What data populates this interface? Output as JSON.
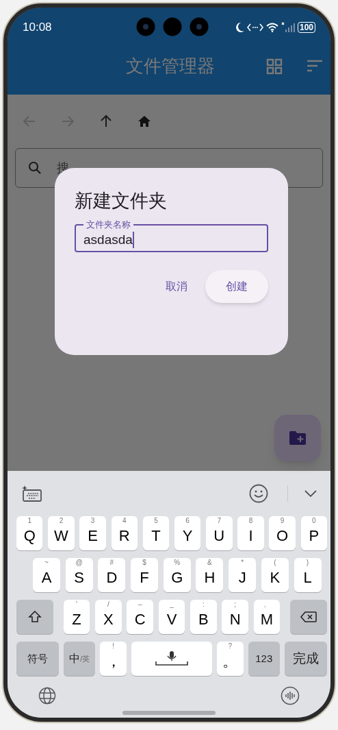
{
  "status_bar": {
    "time": "10:08",
    "battery": "100"
  },
  "app_bar": {
    "title": "文件管理器"
  },
  "search": {
    "placeholder": "搜"
  },
  "dialog": {
    "title": "新建文件夹",
    "field_label": "文件夹名称",
    "value": "asdasda",
    "buttons": [
      {
        "label": "取消",
        "kind": "text"
      },
      {
        "label": "创建",
        "kind": "tonal"
      }
    ]
  },
  "keyboard": {
    "rows": [
      {
        "keys": [
          {
            "label": "Q",
            "hint": "1"
          },
          {
            "label": "W",
            "hint": "2"
          },
          {
            "label": "E",
            "hint": "3"
          },
          {
            "label": "R",
            "hint": "4"
          },
          {
            "label": "T",
            "hint": "5"
          },
          {
            "label": "Y",
            "hint": "6"
          },
          {
            "label": "U",
            "hint": "7"
          },
          {
            "label": "I",
            "hint": "8"
          },
          {
            "label": "O",
            "hint": "9"
          },
          {
            "label": "P",
            "hint": "0"
          }
        ]
      },
      {
        "keys": [
          {
            "label": "A",
            "hint": "~"
          },
          {
            "label": "S",
            "hint": "@"
          },
          {
            "label": "D",
            "hint": "#"
          },
          {
            "label": "F",
            "hint": "$"
          },
          {
            "label": "G",
            "hint": "%"
          },
          {
            "label": "H",
            "hint": "&"
          },
          {
            "label": "J",
            "hint": "*"
          },
          {
            "label": "K",
            "hint": "("
          },
          {
            "label": "L",
            "hint": ")"
          }
        ]
      },
      {
        "keys": [
          {
            "kind": "shift"
          },
          {
            "label": "Z",
            "hint": "'"
          },
          {
            "label": "X",
            "hint": "/"
          },
          {
            "label": "C",
            "hint": "–"
          },
          {
            "label": "V",
            "hint": "_"
          },
          {
            "label": "B",
            "hint": ":"
          },
          {
            "label": "N",
            "hint": ";"
          },
          {
            "label": "M",
            "hint": "、"
          },
          {
            "kind": "delete"
          }
        ]
      },
      {
        "keys": [
          {
            "kind": "function",
            "label": "符号"
          },
          {
            "kind": "lang",
            "label": "中",
            "sub": "/英"
          },
          {
            "label": "，",
            "hint": "!"
          },
          {
            "kind": "space"
          },
          {
            "label": "。",
            "hint": "?"
          },
          {
            "kind": "function",
            "label": "123"
          },
          {
            "kind": "done",
            "label": "完成"
          }
        ]
      }
    ]
  }
}
